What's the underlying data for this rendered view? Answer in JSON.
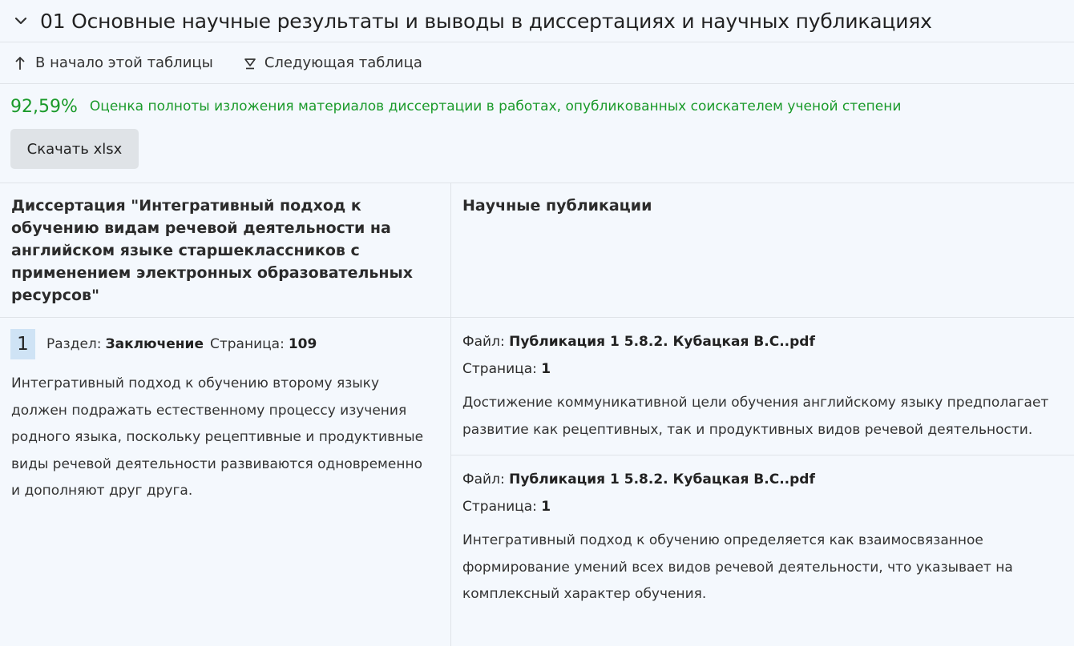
{
  "section": {
    "title": "01 Основные научные результаты и выводы в диссертациях и научных публикациях"
  },
  "nav": {
    "to_top": "В начало этой таблицы",
    "next_table": "Следующая таблица"
  },
  "score": {
    "value": "92,59%",
    "label": "Оценка полноты изложения материалов диссертации в работах, опубликованных соискателем ученой степени"
  },
  "download": {
    "label": "Скачать xlsx"
  },
  "table": {
    "left_header": "Диссертация \"Интегративный подход к обучению видам речевой деятельности на английском языке старшеклассников с применением электронных образовательных ресурсов\"",
    "right_header": "Научные публикации",
    "rows": [
      {
        "number": "1",
        "section_label": "Раздел:",
        "section_value": "Заключение",
        "page_label": "Страница:",
        "page_value": "109",
        "text": "Интегративный подход к обучению второму языку должен подражать естественному процессу изучения родного языка, поскольку рецептивные и продуктивные виды речевой деятельности развиваются одновременно и дополняют друг друга.",
        "publications": [
          {
            "file_label": "Файл:",
            "file_value": "Публикация 1 5.8.2. Кубацкая В.С..pdf",
            "page_label": "Страница:",
            "page_value": "1",
            "text": "Достижение коммуникативной цели обучения английскому языку предполагает развитие как рецептивных, так и продуктивных видов речевой деятельности."
          },
          {
            "file_label": "Файл:",
            "file_value": "Публикация 1 5.8.2. Кубацкая В.С..pdf",
            "page_label": "Страница:",
            "page_value": "1",
            "text": "Интегративный подход к обучению определяется как взаимосвязанное формирование умений всех видов речевой деятельности, что указывает на комплексный характер обучения."
          }
        ]
      }
    ]
  },
  "icons": {
    "collapse": "chevron-down-icon",
    "to_top": "arrow-up-icon",
    "next": "next-table-icon"
  },
  "colors": {
    "score_green": "#1a9a2a",
    "badge_bg": "#cfe3f5",
    "page_bg": "#f4f8fd"
  }
}
